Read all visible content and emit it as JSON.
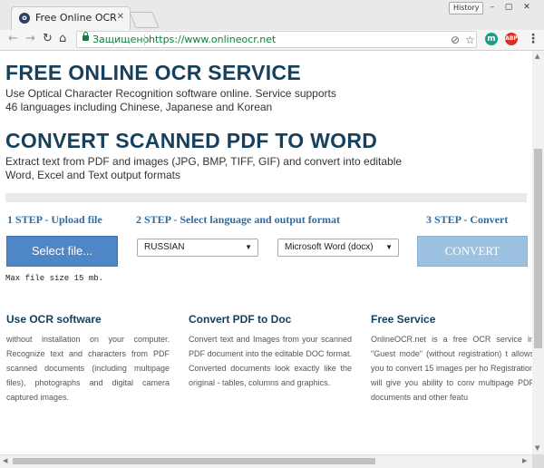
{
  "browser": {
    "tab_title": "Free Online OCR - conve",
    "tab_icon": "site-favicon",
    "history_label": "History",
    "window_controls": {
      "minimize": "–",
      "maximize": "▢",
      "close": "✕"
    },
    "nav": {
      "back": "←",
      "forward": "→",
      "reload": "↻",
      "home": "⌂"
    },
    "address": {
      "secure_label": "Защищено",
      "url": "https://www.onlineocr.net"
    },
    "extensions": [
      {
        "name": "translate-icon",
        "color": "#5f6368",
        "glyph": "⊘"
      },
      {
        "name": "star-icon",
        "color": "#555555",
        "glyph": "☆"
      },
      {
        "name": "extension-m-icon",
        "color": "#16a085",
        "glyph": "m"
      },
      {
        "name": "adblock-icon",
        "color": "#d93025",
        "glyph": "ABP"
      }
    ],
    "menu": "⋮"
  },
  "hero": {
    "title1": "FREE ONLINE OCR SERVICE",
    "text1_line1": "Use Optical Character Recognition software online. Service supports",
    "text1_line2": "46 languages including Chinese, Japanese and Korean",
    "title2": "CONVERT SCANNED PDF TO WORD",
    "text2_line1": "Extract text from PDF and images (JPG, BMP, TIFF, GIF) and convert into editable",
    "text2_line2": "Word, Excel and Text output formats"
  },
  "steps": {
    "step1": "1 STEP - Upload file",
    "step2": "2 STEP - Select language and output format",
    "step3": "3 STEP - Convert",
    "select_file": "Select file...",
    "language": "RUSSIAN",
    "format": "Microsoft Word (docx)",
    "convert": "CONVERT",
    "max_size": "Max file size 15 mb."
  },
  "features": [
    {
      "title": "Use OCR software",
      "text": "without installation on your computer. Recognize text and characters from PDF scanned documents (including multipage files), photographs and digital camera captured images."
    },
    {
      "title": "Convert PDF to Doc",
      "text": "Convert text and Images from your scanned PDF document into the editable DOC format. Converted documents look exactly like the original - tables, columns and graphics."
    },
    {
      "title": "Free Service",
      "text": "OnlineOCR.net is a free OCR service in \"Guest mode\" (without registration) t allows you to convert 15 images per ho Registration will give you ability to conv multipage PDF documents and other featu"
    }
  ],
  "colors": {
    "heading": "#16405b",
    "step": "#2e6da4",
    "select_button": "#4f86c6",
    "convert_button": "#9dc1e0",
    "secure": "#0b8043"
  }
}
